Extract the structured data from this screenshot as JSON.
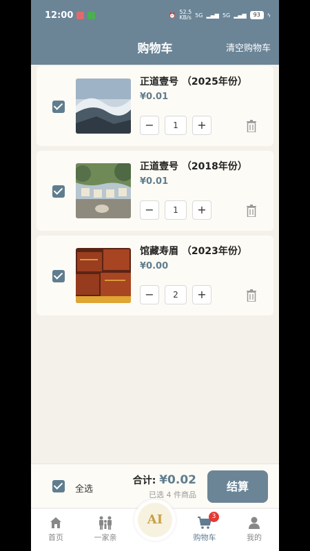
{
  "status": {
    "time": "12:00",
    "speed": "52.5\nKB/s",
    "net1": "5G",
    "net2": "5G",
    "battery": "93"
  },
  "header": {
    "title": "购物车",
    "clear_label": "清空购物车"
  },
  "items": [
    {
      "name": "正道壹号 （2025年份）",
      "price": "¥0.01",
      "qty": "1",
      "checked": true,
      "thumb": "mountain-mist-photo"
    },
    {
      "name": "正道壹号 （2018年份）",
      "price": "¥0.01",
      "qty": "1",
      "checked": true,
      "thumb": "mountain-sign-photo"
    },
    {
      "name": "馆藏寿眉 （2023年份）",
      "price": "¥0.00",
      "qty": "2",
      "checked": true,
      "thumb": "tea-box-photo"
    }
  ],
  "stepper": {
    "minus": "−",
    "plus": "+"
  },
  "checkout": {
    "select_all": "全选",
    "total_label": "合计:",
    "total_value": "¥0.02",
    "selected_text": "已选 4 件商品",
    "pay_label": "结算"
  },
  "tabs": [
    {
      "label": "首页",
      "icon": "home-icon"
    },
    {
      "label": "一家亲",
      "icon": "family-icon"
    },
    {
      "label": "AI",
      "icon": "ai-icon"
    },
    {
      "label": "购物车",
      "icon": "cart-icon",
      "badge": "3"
    },
    {
      "label": "我的",
      "icon": "person-icon"
    }
  ],
  "colors": {
    "primary": "#6b8597",
    "accent": "#5f7d8f",
    "badge": "#e53935",
    "ai_gold": "#c9a047"
  }
}
